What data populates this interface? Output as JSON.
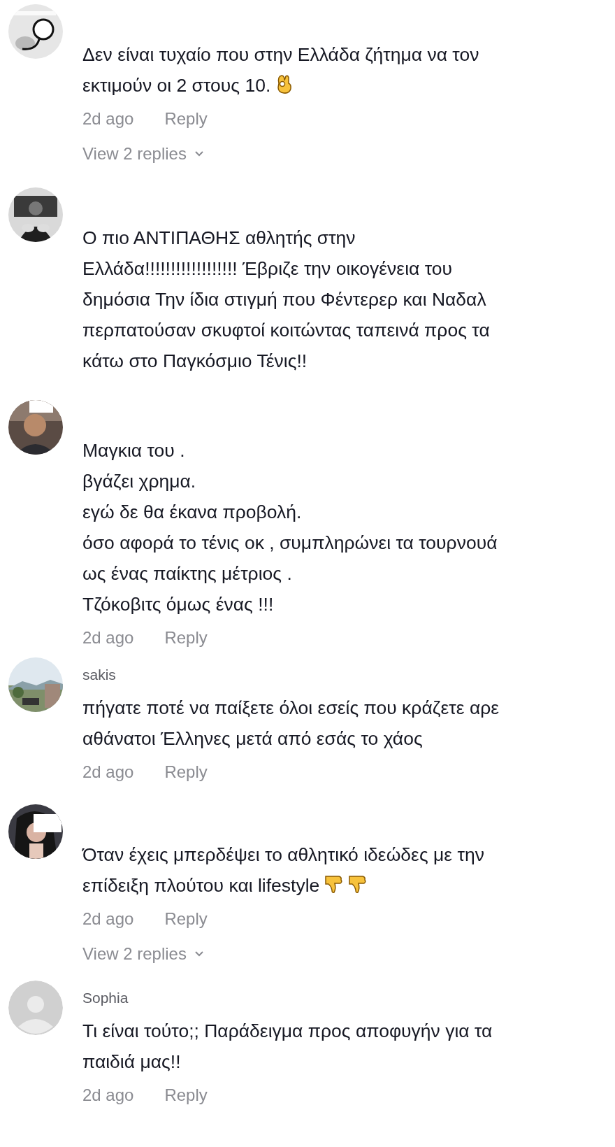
{
  "comments": [
    {
      "avatar": {
        "kind": "picture"
      },
      "text": "Δεν είναι τυχαίο που στην Ελλάδα ζήτημα να τον\nεκτιμούν οι 2 στους 10.",
      "reaction_icons": [
        {
          "kind": "ok_hand"
        }
      ],
      "time": "2d ago",
      "reply": "Reply",
      "view_replies": "View 2 replies"
    },
    {
      "avatar": {
        "kind": "picture"
      },
      "text": "Ο πιο ΑΝΤΙΠΑΘΗΣ αθλητής στην\nΕλλάδα!!!!!!!!!!!!!!!!!! Έβριζε την οικογένεια του\nδημόσια Την ίδια στιγμή που Φέντερερ και Ναδαλ\nπερπατούσαν σκυφτοί κοιτώντας ταπεινά προς τα\nκάτω στο Παγκόσμιο Τένις!!"
    },
    {
      "avatar": {
        "kind": "picture"
      },
      "text": "Μαγκια του .\nβγάζει χρημα.\nεγώ δε θα έκανα προβολή.\nόσο αφορά το τένις οκ , συμπληρώνει τα τουρνουά\nως ένας παίκτης μέτριος .\nΤζόκοβιτς όμως ένας !!!",
      "time": "2d ago",
      "reply": "Reply"
    },
    {
      "avatar": {
        "kind": "picture"
      },
      "username": "sakis",
      "text": "πήγατε ποτέ να παίξετε όλοι εσείς που κράζετε αρε\nαθάνατοι Έλληνες μετά από εσάς το χάος",
      "time": "2d ago",
      "reply": "Reply"
    },
    {
      "avatar": {
        "kind": "picture"
      },
      "text": "Όταν έχεις μπερδέψει το αθλητικό ιδεώδες με την\nεπίδειξη πλούτου και lifestyle",
      "reaction_icons": [
        {
          "kind": "thumbs_down"
        },
        {
          "kind": "thumbs_down"
        }
      ],
      "time": "2d ago",
      "reply": "Reply",
      "view_replies": "View 2 replies"
    },
    {
      "avatar": {
        "kind": "default"
      },
      "username": "Sophia",
      "text": "Τι είναι τούτο;; Παράδειγμα προς αποφυγήν για τα\nπαιδιά μας!!",
      "time": "2d ago",
      "reply": "Reply"
    }
  ]
}
